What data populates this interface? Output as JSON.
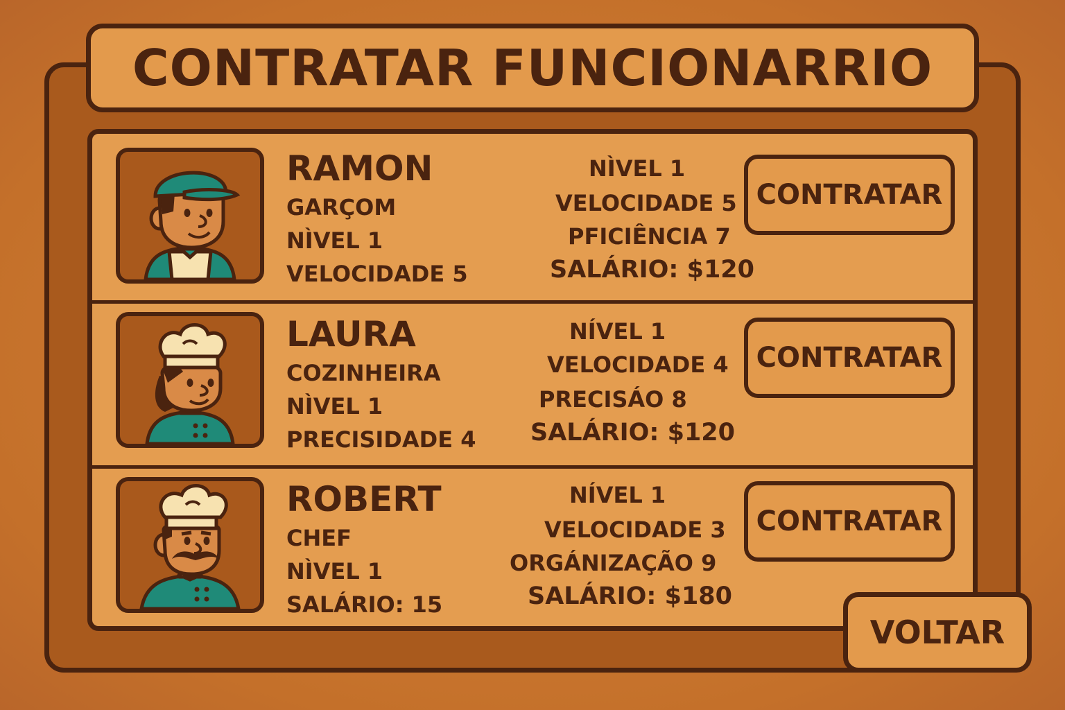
{
  "title": "CONTRATAR FUNCIONARRIO",
  "colors": {
    "background": "#c8742c",
    "panel": "#e49d50",
    "outline": "#4a230f",
    "uniform": "#1f8a78",
    "hat": "#f7e2b0"
  },
  "candidates": [
    {
      "name": "RAMON",
      "avatar_icon": "waiter-avatar-icon",
      "left_stats": [
        "GARÇOM",
        "NÌVEL 1",
        "VELOCIDADE 5"
      ],
      "right_stats": [
        "NÌVEL 1",
        "VELOCIDADE 5",
        "PFICIÊNCIA 7",
        "SALÁRIO: $120"
      ],
      "hire_label": "CONTRATAR"
    },
    {
      "name": "LAURA",
      "avatar_icon": "cook-avatar-icon",
      "left_stats": [
        "COZINHEIRA",
        "NÌVEL 1",
        "PRECISIDADE 4"
      ],
      "right_stats": [
        "NÍVEL 1",
        "VELOCIDADE 4",
        "PRECISÁO 8",
        "SALÁRIO: $120"
      ],
      "hire_label": "CONTRATAR"
    },
    {
      "name": "ROBERT",
      "avatar_icon": "chef-avatar-icon",
      "left_stats": [
        "CHEF",
        "NÌVEL 1",
        "SALÁRIO: 15"
      ],
      "right_stats": [
        "NÍVEL 1",
        "VELOCIDADE 3",
        "ORGÁNIZAÇÃO 9",
        "SALÁRIO: $180"
      ],
      "hire_label": "CONTRATAR"
    }
  ],
  "back_label": "VOLTAR"
}
